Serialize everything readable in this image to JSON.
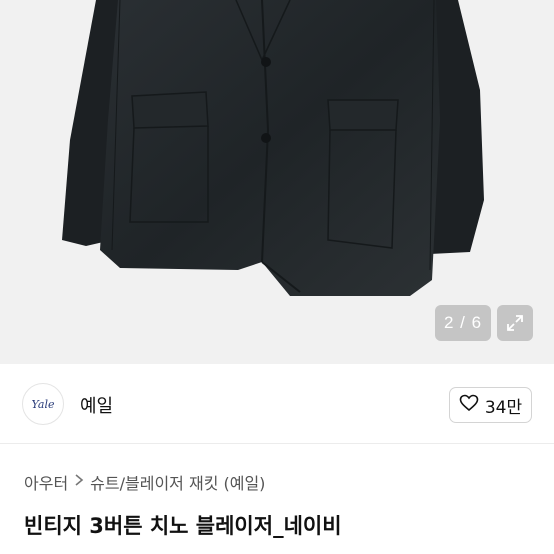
{
  "product_image": {
    "counter": "2 / 6",
    "expand_icon": "expand-icon"
  },
  "seller": {
    "avatar_text": "Yale",
    "name": "예일"
  },
  "like": {
    "icon": "heart-icon",
    "count": "34만"
  },
  "breadcrumb": {
    "items": [
      "아우터",
      "슈트/블레이저 재킷 (예일)"
    ],
    "separator_icon": "chevron-right-icon"
  },
  "product": {
    "title": "빈티지 3버튼 치노 블레이저_네이비"
  }
}
